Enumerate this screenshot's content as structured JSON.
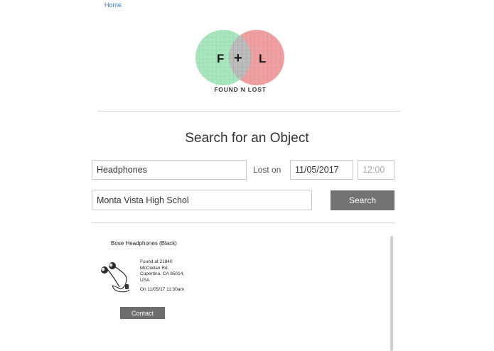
{
  "nav": {
    "home_label": "Home"
  },
  "logo": {
    "left_letter": "F",
    "center_symbol": "+",
    "right_letter": "L",
    "caption": "FOUND N LOST",
    "colors": {
      "left_circle": "#a8e6bd",
      "right_circle": "#f0a0a0",
      "overlap": "#bdbdbd"
    }
  },
  "search": {
    "title": "Search for an Object",
    "object_value": "Headphones",
    "lost_on_label": "Lost on",
    "date_value": "11/05/2017",
    "time_placeholder": "12:00",
    "location_value": "Monta Vista High Schol",
    "search_button_label": "Search"
  },
  "results": [
    {
      "title": "Bose Headphones (Black)",
      "found_text": "Found at 21840\nMcClellan Rd,\nCupertino, CA 95014,\nUSA",
      "found_date": "On 11/05/17 11:30am",
      "contact_label": "Contact",
      "image_icon": "earbuds-image"
    }
  ]
}
